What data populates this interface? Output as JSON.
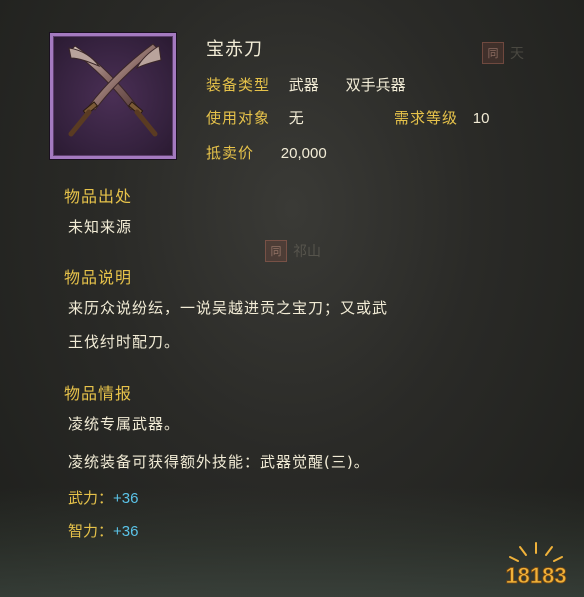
{
  "item": {
    "name": "宝赤刀",
    "equip_type_label": "装备类型",
    "equip_type_value": "武器",
    "equip_subtype_value": "双手兵器",
    "user_label": "使用对象",
    "user_value": "无",
    "level_label": "需求等级",
    "level_value": "10",
    "sell_label": "抵卖价",
    "sell_value": "20,000",
    "icon": "twin-blades-icon"
  },
  "sections": {
    "origin": {
      "title": "物品出处",
      "text": "未知来源"
    },
    "desc": {
      "title": "物品说明",
      "line1": "来历众说纷纭，一说吴越进贡之宝刀；又或武",
      "line2": "王伐纣时配刀。"
    },
    "info": {
      "title": "物品情报",
      "line1": "凌统专属武器。",
      "line2": "凌统装备可获得额外技能：武器觉醒(三)。"
    }
  },
  "stats": [
    {
      "label": "武力：",
      "value": "+36"
    },
    {
      "label": "智力：",
      "value": "+36"
    }
  ],
  "background": {
    "mark1_seal": "同",
    "mark1_text": "天",
    "mark2_seal": "同",
    "mark2_text": "祁山"
  },
  "logo": {
    "text": "18183"
  },
  "colors": {
    "label": "#e6c24a",
    "text": "#f2ecd6",
    "stat": "#5bc3e8",
    "frame": "#a47ac0"
  }
}
